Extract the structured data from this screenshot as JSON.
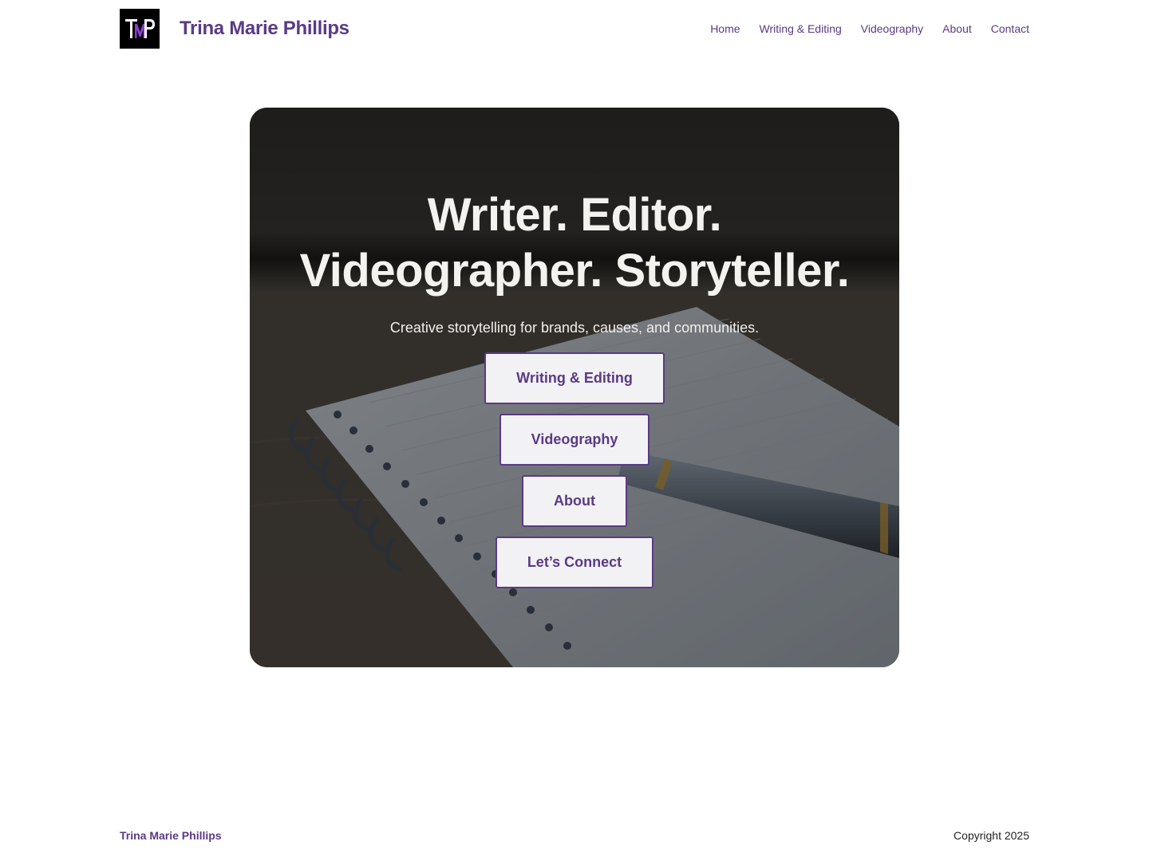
{
  "header": {
    "logo_text": "TMP",
    "site_title": "Trina Marie Phillips",
    "nav": [
      {
        "label": "Home"
      },
      {
        "label": "Writing & Editing"
      },
      {
        "label": "Videography"
      },
      {
        "label": "About"
      },
      {
        "label": "Contact"
      }
    ]
  },
  "hero": {
    "title_line1": "Writer. Editor.",
    "title_line2": "Videographer. Storyteller.",
    "subtitle": "Creative storytelling for brands, causes, and communities.",
    "buttons": [
      {
        "label": "Writing & Editing"
      },
      {
        "label": "Videography"
      },
      {
        "label": "About"
      },
      {
        "label": "Let’s Connect"
      }
    ]
  },
  "footer": {
    "brand": "Trina Marie Phillips",
    "copyright": "Copyright 2025"
  },
  "colors": {
    "brand_purple": "#5a3a85",
    "logo_accent": "#8b3fd1",
    "button_bg": "#f2f1f3",
    "logo_bg": "#000000"
  }
}
